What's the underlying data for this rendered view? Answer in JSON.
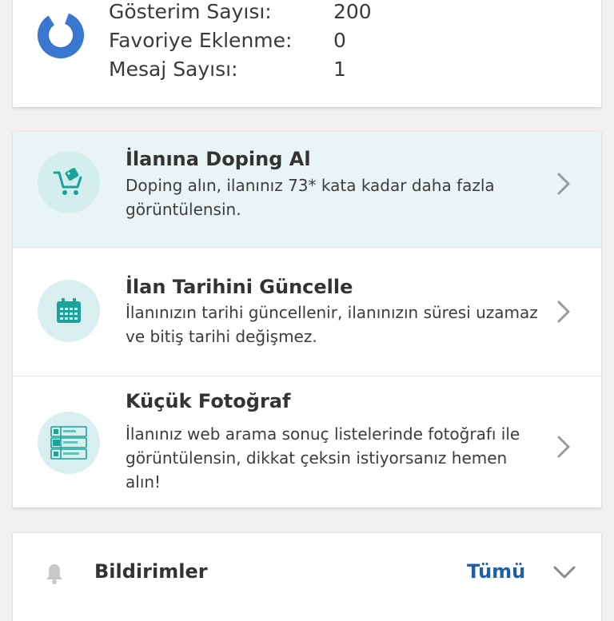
{
  "stats": {
    "icon": "pie-chart-icon",
    "rows": [
      {
        "label": "Gösterim Sayısı:",
        "value": "200"
      },
      {
        "label": "Favoriye Eklenme:",
        "value": "0"
      },
      {
        "label": "Mesaj Sayısı:",
        "value": "1"
      }
    ]
  },
  "options": [
    {
      "icon": "cart-tag-icon",
      "title": "İlanına Doping Al",
      "description": "Doping alın, ilanınız 73* kata kadar daha fazla görüntülensin."
    },
    {
      "icon": "calendar-icon",
      "title": "İlan Tarihini Güncelle",
      "description": "İlanınızın tarihi güncellenir, ilanınızın süresi uzamaz ve bitiş tarihi değişmez."
    },
    {
      "icon": "listing-thumbnail-icon",
      "title": "Küçük Fotoğraf",
      "description": "İlanınız web arama sonuç listelerinde fotoğrafı ile görüntülensin, dikkat çeksin istiyorsanız hemen alın!"
    }
  ],
  "notifications": {
    "icon": "bell-icon",
    "title": "Bildirimler",
    "all_label": "Tümü"
  },
  "colors": {
    "accent_teal": "#1aa39a",
    "chart_blue": "#3a78d0",
    "link_blue": "#1f5fa8",
    "highlight_bg": "#e9f5f5"
  }
}
